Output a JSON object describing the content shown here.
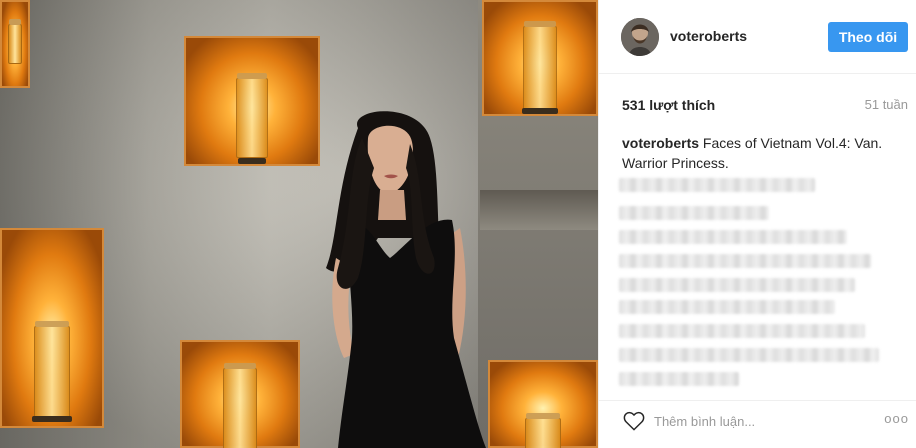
{
  "post": {
    "username": "voteroberts",
    "follow_label": "Theo dõi",
    "likes": "531 lượt thích",
    "time_ago": "51 tuần",
    "caption_user": "voteroberts",
    "caption_text": " Faces of Vietnam Vol.4: Van. Warrior Princess.",
    "comment_placeholder": "Thêm bình luận...",
    "more_label": "ooo"
  },
  "icons": {
    "heart": "heart-icon",
    "more": "more-options-icon"
  },
  "colors": {
    "accent": "#3897f0",
    "text": "#262626",
    "muted": "#999999"
  }
}
